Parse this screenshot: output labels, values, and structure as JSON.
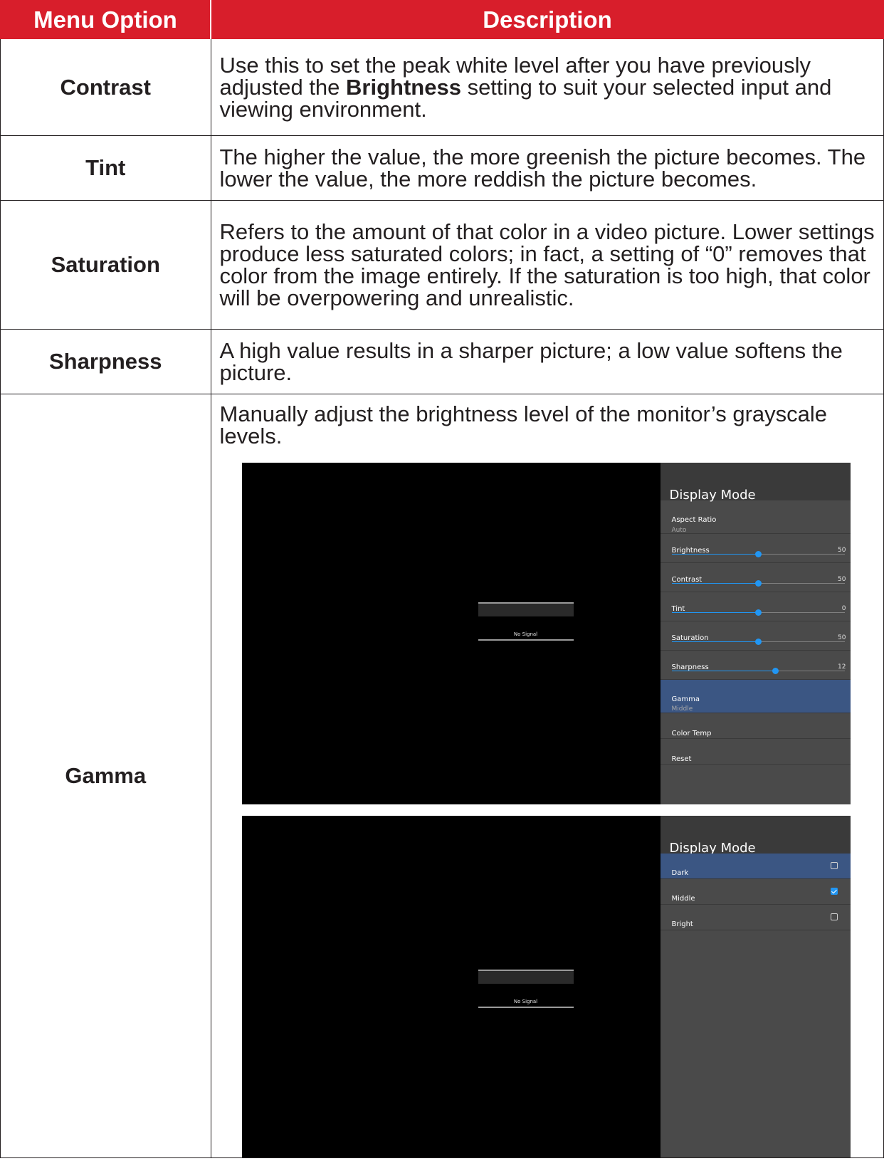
{
  "header": {
    "col_option": "Menu Option",
    "col_description": "Description"
  },
  "rows": [
    {
      "option": "Contrast",
      "desc_before": "Use this to set the peak white level after you have previously adjusted the ",
      "desc_bold": "Brightness",
      "desc_after": " setting to suit your selected input and viewing environment."
    },
    {
      "option": "Tint",
      "description": "The higher the value, the more greenish the picture becomes. The lower the value, the more reddish the picture becomes."
    },
    {
      "option": "Saturation",
      "description": "Refers to the amount of that color in a video picture. Lower settings produce less saturated colors; in fact, a setting of “0” removes that color from the image entirely. If the saturation is too high, that color will be overpowering and unrealistic."
    },
    {
      "option": "Sharpness",
      "description": "A high value results in a sharper picture; a low value softens the picture."
    },
    {
      "option": "Gamma",
      "description": "Manually adjust the brightness level of the monitor’s grayscale levels."
    }
  ],
  "screenshot1": {
    "no_signal": "No Signal",
    "panel_title": "Display Mode",
    "aspect": {
      "label": "Aspect Ratio",
      "value": "Auto"
    },
    "sliders": [
      {
        "label": "Brightness",
        "value": "50",
        "level": 50
      },
      {
        "label": "Contrast",
        "value": "50",
        "level": 50
      },
      {
        "label": "Tint",
        "value": "0",
        "level": 50
      },
      {
        "label": "Saturation",
        "value": "50",
        "level": 50
      },
      {
        "label": "Sharpness",
        "value": "12",
        "level": 60
      }
    ],
    "gamma": {
      "label": "Gamma",
      "value": "Middle"
    },
    "color_temp": "Color Temp",
    "reset": "Reset"
  },
  "screenshot2": {
    "no_signal": "No Signal",
    "panel_title": "Display Mode",
    "options": [
      {
        "label": "Dark",
        "checked": false
      },
      {
        "label": "Middle",
        "checked": true
      },
      {
        "label": "Bright",
        "checked": false
      }
    ]
  },
  "colors": {
    "header_bg": "#d81e2b",
    "selected_item": "#3b5683",
    "slider_accent": "#2196f3"
  }
}
